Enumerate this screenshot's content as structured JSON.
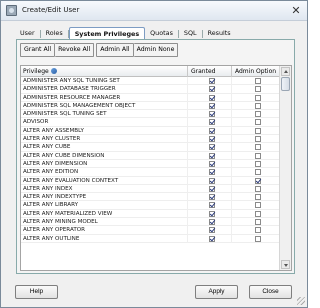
{
  "window": {
    "title": "Create/Edit User"
  },
  "tabs": [
    {
      "label": "User"
    },
    {
      "label": "Roles"
    },
    {
      "label": "System Privileges",
      "active": true
    },
    {
      "label": "Quotas"
    },
    {
      "label": "SQL"
    },
    {
      "label": "Results"
    }
  ],
  "toolbar": {
    "grant_all": "Grant All",
    "revoke_all": "Revoke All",
    "admin_all": "Admin All",
    "admin_none": "Admin None"
  },
  "grid": {
    "columns": {
      "privilege": "Privilege",
      "granted": "Granted",
      "admin": "Admin Option"
    },
    "rows": [
      {
        "name": "ADMINISTER ANY SQL TUNING SET",
        "granted": true,
        "admin": false
      },
      {
        "name": "ADMINISTER DATABASE TRIGGER",
        "granted": true,
        "admin": false
      },
      {
        "name": "ADMINISTER RESOURCE MANAGER",
        "granted": true,
        "admin": false
      },
      {
        "name": "ADMINISTER SQL MANAGEMENT OBJECT",
        "granted": true,
        "admin": false
      },
      {
        "name": "ADMINISTER SQL TUNING SET",
        "granted": true,
        "admin": false
      },
      {
        "name": "ADVISOR",
        "granted": true,
        "admin": false
      },
      {
        "name": "ALTER ANY ASSEMBLY",
        "granted": true,
        "admin": false
      },
      {
        "name": "ALTER ANY CLUSTER",
        "granted": true,
        "admin": false
      },
      {
        "name": "ALTER ANY CUBE",
        "granted": true,
        "admin": false
      },
      {
        "name": "ALTER ANY CUBE DIMENSION",
        "granted": true,
        "admin": false
      },
      {
        "name": "ALTER ANY DIMENSION",
        "granted": true,
        "admin": false
      },
      {
        "name": "ALTER ANY EDITION",
        "granted": true,
        "admin": false
      },
      {
        "name": "ALTER ANY EVALUATION CONTEXT",
        "granted": true,
        "admin": true
      },
      {
        "name": "ALTER ANY INDEX",
        "granted": true,
        "admin": false
      },
      {
        "name": "ALTER ANY INDEXTYPE",
        "granted": true,
        "admin": false
      },
      {
        "name": "ALTER ANY LIBRARY",
        "granted": true,
        "admin": false
      },
      {
        "name": "ALTER ANY MATERIALIZED VIEW",
        "granted": true,
        "admin": false
      },
      {
        "name": "ALTER ANY MINING MODEL",
        "granted": true,
        "admin": false
      },
      {
        "name": "ALTER ANY OPERATOR",
        "granted": true,
        "admin": false
      },
      {
        "name": "ALTER ANY OUTLINE",
        "granted": true,
        "admin": false
      }
    ]
  },
  "footer": {
    "help": "Help",
    "apply": "Apply",
    "close": "Close"
  }
}
